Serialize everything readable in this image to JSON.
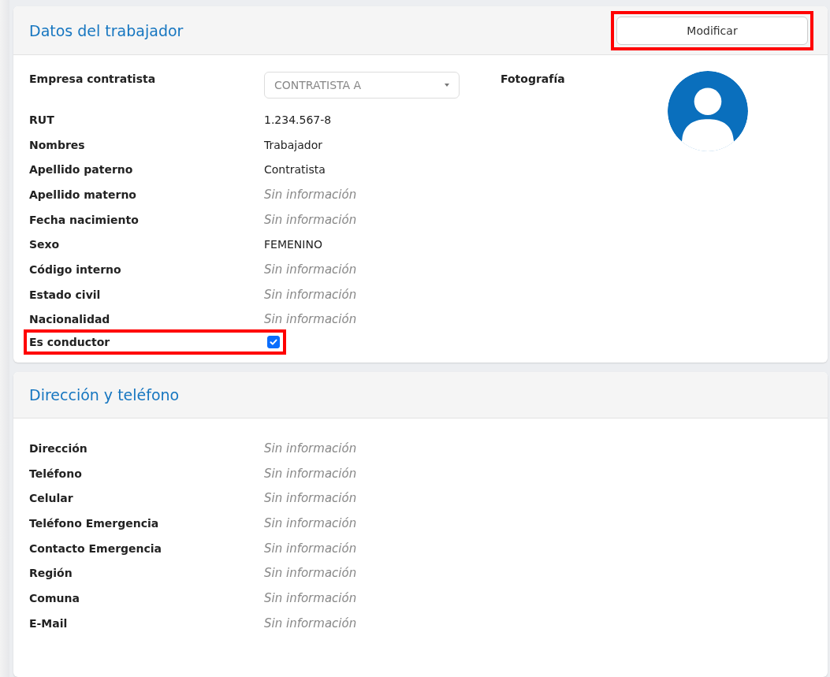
{
  "worker": {
    "title": "Datos del trabajador",
    "modify_button": {
      "label": "Modificar",
      "highlighted": true
    },
    "photo_label": "Fotografía",
    "fields": [
      {
        "kind": "select",
        "label": "Empresa contratista",
        "value": "CONTRATISTA A"
      },
      {
        "kind": "text",
        "label": "RUT",
        "value": "1.234.567-8"
      },
      {
        "kind": "text",
        "label": "Nombres",
        "value": "Trabajador"
      },
      {
        "kind": "text",
        "label": "Apellido paterno",
        "value": "Contratista"
      },
      {
        "kind": "empty",
        "label": "Apellido materno",
        "value": "Sin información"
      },
      {
        "kind": "empty",
        "label": "Fecha nacimiento",
        "value": "Sin información"
      },
      {
        "kind": "text",
        "label": "Sexo",
        "value": "FEMENINO"
      },
      {
        "kind": "empty",
        "label": "Código interno",
        "value": "Sin información"
      },
      {
        "kind": "empty",
        "label": "Estado civil",
        "value": "Sin información"
      },
      {
        "kind": "empty",
        "label": "Nacionalidad",
        "value": "Sin información"
      },
      {
        "kind": "checkbox",
        "label": "Es conductor",
        "checked": true,
        "highlighted": true
      }
    ]
  },
  "contact": {
    "title": "Dirección y teléfono",
    "fields": [
      {
        "kind": "empty",
        "label": "Dirección",
        "value": "Sin información"
      },
      {
        "kind": "empty",
        "label": "Teléfono",
        "value": "Sin información"
      },
      {
        "kind": "empty",
        "label": "Celular",
        "value": "Sin información"
      },
      {
        "kind": "empty",
        "label": "Teléfono Emergencia",
        "value": "Sin información"
      },
      {
        "kind": "empty",
        "label": "Contacto Emergencia",
        "value": "Sin información"
      },
      {
        "kind": "empty",
        "label": "Región",
        "value": "Sin información"
      },
      {
        "kind": "empty",
        "label": "Comuna",
        "value": "Sin información"
      },
      {
        "kind": "empty",
        "label": "E-Mail",
        "value": "Sin información"
      }
    ]
  }
}
